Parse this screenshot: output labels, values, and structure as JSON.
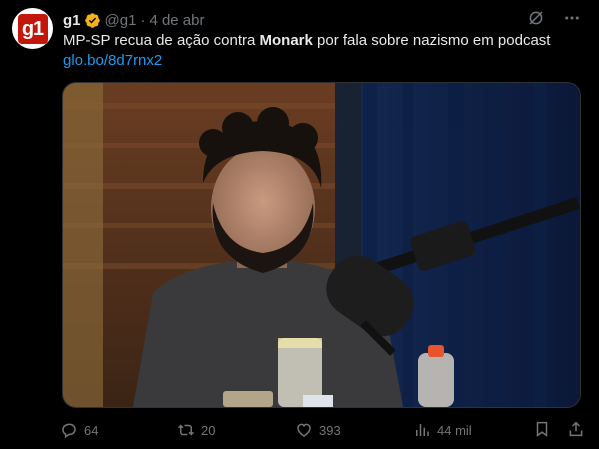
{
  "author": {
    "avatar_text": "g1",
    "name": "g1",
    "handle": "@g1",
    "separator": "·",
    "time": "4 de abr"
  },
  "post": {
    "text_before": "MP-SP recua de ação contra ",
    "text_bold": "Monark",
    "text_after": " por fala sobre nazismo em podcast",
    "link": "glo.bo/8d7rnx2"
  },
  "actions": {
    "replies": "64",
    "reposts": "20",
    "likes": "393",
    "views": "44 mil"
  },
  "colors": {
    "background": "#000000",
    "text": "#e7e9ea",
    "muted": "#71767b",
    "link": "#1d9bf0",
    "brand": "#c4170c",
    "verified": "#f4b21c"
  },
  "icons": [
    "verified-badge-icon",
    "grok-icon",
    "more-icon",
    "reply-icon",
    "repost-icon",
    "like-icon",
    "views-icon",
    "bookmark-icon",
    "share-icon"
  ]
}
